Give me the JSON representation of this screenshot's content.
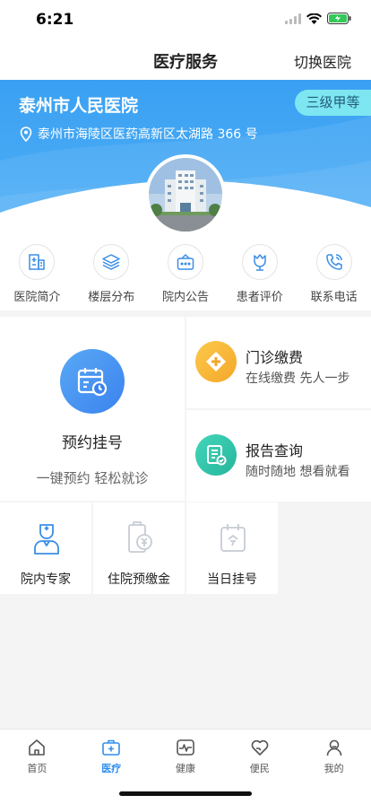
{
  "status": {
    "time": "6:21"
  },
  "nav": {
    "title": "医疗服务",
    "action": "切换医院"
  },
  "hospital": {
    "name": "泰州市人民医院",
    "level": "三级甲等",
    "address": "泰州市海陵区医药高新区太湖路 366 号"
  },
  "quick": [
    {
      "label": "医院简介",
      "icon": "hospital-building-icon"
    },
    {
      "label": "楼层分布",
      "icon": "layers-icon"
    },
    {
      "label": "院内公告",
      "icon": "announcement-icon"
    },
    {
      "label": "患者评价",
      "icon": "tulip-icon"
    },
    {
      "label": "联系电话",
      "icon": "phone-icon"
    }
  ],
  "services": {
    "appointment": {
      "title": "预约挂号",
      "subtitle": "一键预约 轻松就诊",
      "icon": "calendar-clock-icon",
      "color": "#3b82ef"
    },
    "payment": {
      "title": "门诊缴费",
      "subtitle": "在线缴费 先人一步",
      "icon": "plus-icon",
      "color": "#f7b731"
    },
    "report": {
      "title": "报告查询",
      "subtitle": "随时随地 想看就看",
      "icon": "report-icon",
      "color": "#2ec4a6"
    },
    "experts": {
      "title": "院内专家",
      "icon": "doctor-icon"
    },
    "deposit": {
      "title": "住院预缴金",
      "icon": "deposit-icon"
    },
    "sameday": {
      "title": "当日挂号",
      "icon": "calendar-today-icon"
    }
  },
  "tabs": [
    {
      "label": "首页",
      "icon": "home-icon",
      "active": false
    },
    {
      "label": "医疗",
      "icon": "medical-kit-icon",
      "active": true
    },
    {
      "label": "健康",
      "icon": "heartbeat-icon",
      "active": false
    },
    {
      "label": "便民",
      "icon": "heart-hand-icon",
      "active": false
    },
    {
      "label": "我的",
      "icon": "user-icon",
      "active": false
    }
  ]
}
